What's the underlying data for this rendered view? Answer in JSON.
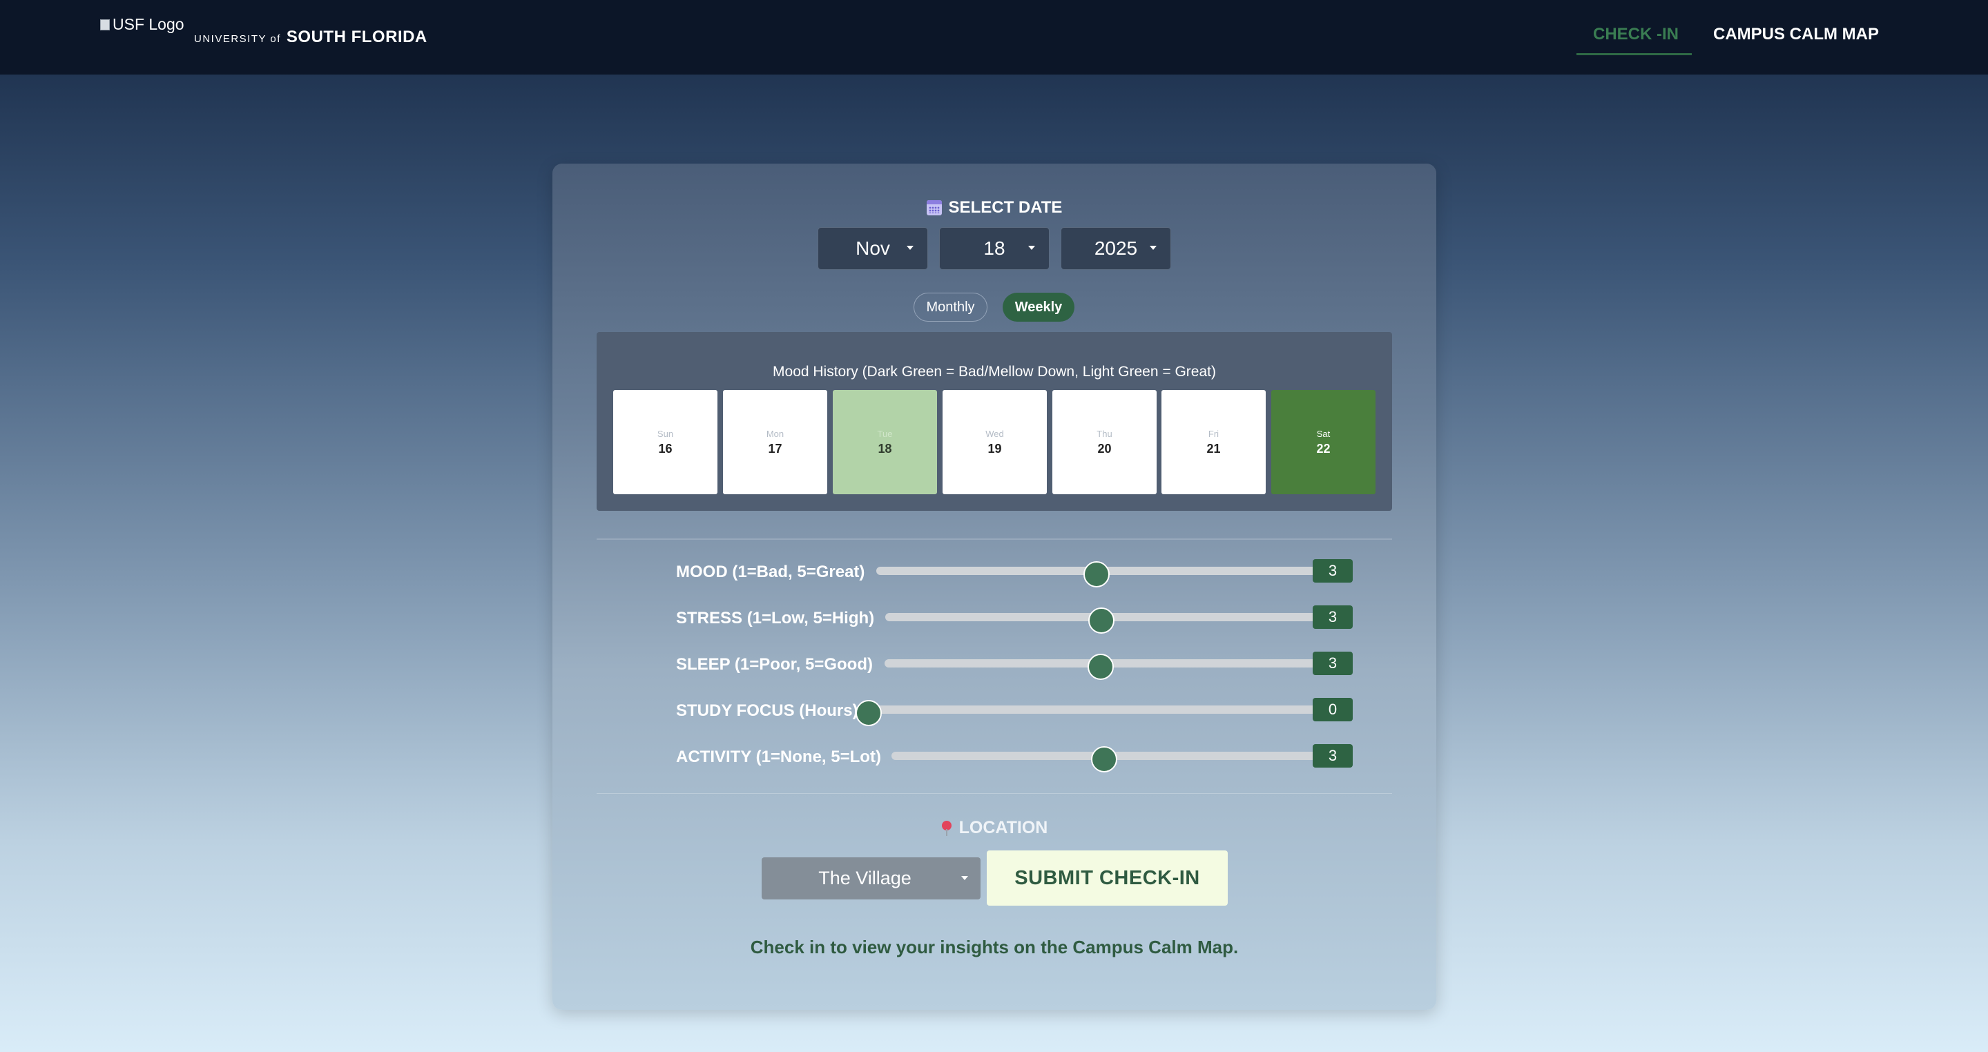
{
  "header": {
    "logo_alt": "USF Logo",
    "university_prefix": "UNIVERSITY of",
    "university_name": "SOUTH FLORIDA",
    "nav": [
      {
        "label": "CHECK -IN",
        "active": true
      },
      {
        "label": "CAMPUS CALM MAP",
        "active": false
      }
    ]
  },
  "date_picker": {
    "title": "SELECT DATE",
    "month": "Nov",
    "day": "18",
    "year": "2025"
  },
  "view_toggle": {
    "monthly_label": "Monthly",
    "weekly_label": "Weekly",
    "active": "Weekly"
  },
  "mood_history": {
    "title": "Mood History (Dark Green = Bad/Mellow Down, Light Green = Great)",
    "days": [
      {
        "name": "Sun",
        "num": "16"
      },
      {
        "name": "Mon",
        "num": "17"
      },
      {
        "name": "Tue",
        "num": "18"
      },
      {
        "name": "Wed",
        "num": "19"
      },
      {
        "name": "Thu",
        "num": "20"
      },
      {
        "name": "Fri",
        "num": "21"
      },
      {
        "name": "Sat",
        "num": "22"
      }
    ]
  },
  "sliders": [
    {
      "label": "MOOD (1=Bad, 5=Great)",
      "value": "3",
      "min": 1,
      "max": 5
    },
    {
      "label": "STRESS (1=Low, 5=High)",
      "value": "3",
      "min": 1,
      "max": 5
    },
    {
      "label": "SLEEP (1=Poor, 5=Good)",
      "value": "3",
      "min": 1,
      "max": 5
    },
    {
      "label": "STUDY FOCUS (Hours)",
      "value": "0",
      "min": 0,
      "max": 12
    },
    {
      "label": "ACTIVITY (1=None, 5=Lot)",
      "value": "3",
      "min": 1,
      "max": 5
    }
  ],
  "location": {
    "title": "LOCATION",
    "selected": "The Village"
  },
  "submit_label": "SUBMIT CHECK-IN",
  "insight_text": "Check in to view your insights on the Campus Calm Map.",
  "colors": {
    "accent_green": "#2e6343",
    "great_green": "#b2d3a8",
    "bad_green": "#4a7f3c",
    "header_bg": "#0c1628"
  }
}
